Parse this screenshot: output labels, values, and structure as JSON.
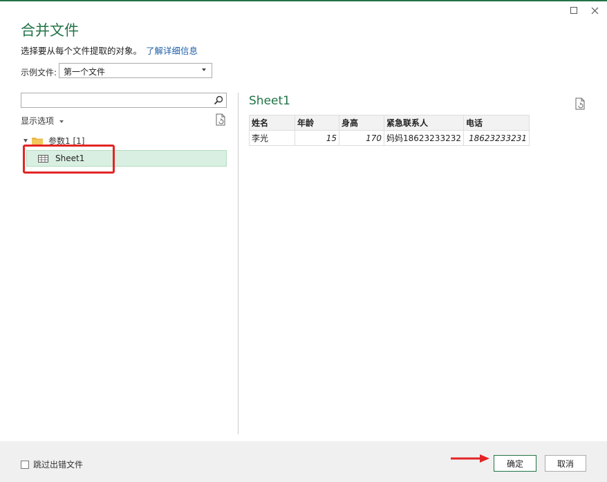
{
  "dialog": {
    "title": "合并文件"
  },
  "description": {
    "text": "选择要从每个文件提取的对象。",
    "link": "了解详细信息"
  },
  "sample_file": {
    "label": "示例文件:",
    "selected": "第一个文件"
  },
  "search": {
    "placeholder": "",
    "value": ""
  },
  "display_options": {
    "label": "显示选项"
  },
  "tree": {
    "folder_label": "参数1 [1]",
    "sheet_label": "Sheet1"
  },
  "preview": {
    "title": "Sheet1",
    "columns": [
      "姓名",
      "年龄",
      "身高",
      "紧急联系人",
      "电话"
    ],
    "rows": [
      [
        "李光",
        "15",
        "170",
        "妈妈18623233232",
        "18623233231"
      ]
    ]
  },
  "footer": {
    "skip_label": "跳过出错文件",
    "ok_label": "确定",
    "cancel_label": "取消"
  },
  "colors": {
    "accent": "#217346",
    "highlight": "#d9efe1",
    "annotation": "#e32424",
    "link": "#1f5fa8"
  }
}
